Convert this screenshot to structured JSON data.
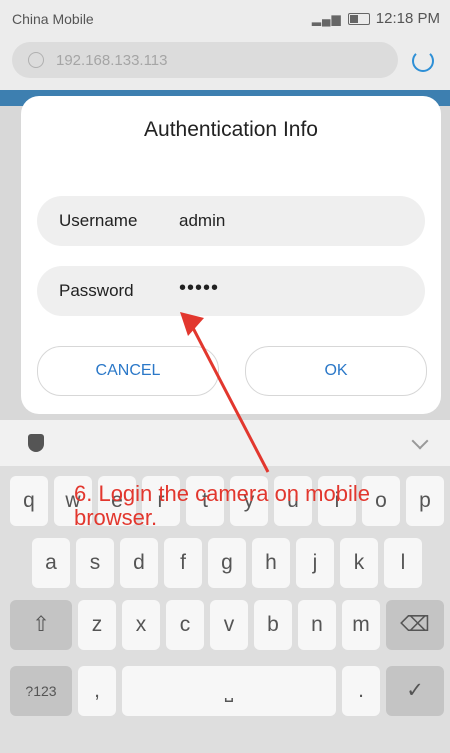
{
  "status": {
    "carrier": "China Mobile",
    "time": "12:18 PM"
  },
  "browser": {
    "url": "192.168.133.113"
  },
  "dialog": {
    "title": "Authentication Info",
    "username_label": "Username",
    "username_value": "admin",
    "password_label": "Password",
    "password_value": "•••••",
    "cancel": "CANCEL",
    "ok": "OK"
  },
  "keyboard": {
    "row1": [
      "q",
      "w",
      "e",
      "r",
      "t",
      "y",
      "u",
      "i",
      "o",
      "p"
    ],
    "row2": [
      "a",
      "s",
      "d",
      "f",
      "g",
      "h",
      "j",
      "k",
      "l"
    ],
    "row3": [
      "z",
      "x",
      "c",
      "v",
      "b",
      "n",
      "m"
    ],
    "numkey": "?123",
    "comma": ",",
    "period": "."
  },
  "annotation": "6. Login the camera on mobile browser.",
  "colors": {
    "accent": "#2b78c8",
    "annotation": "#e2372e"
  }
}
